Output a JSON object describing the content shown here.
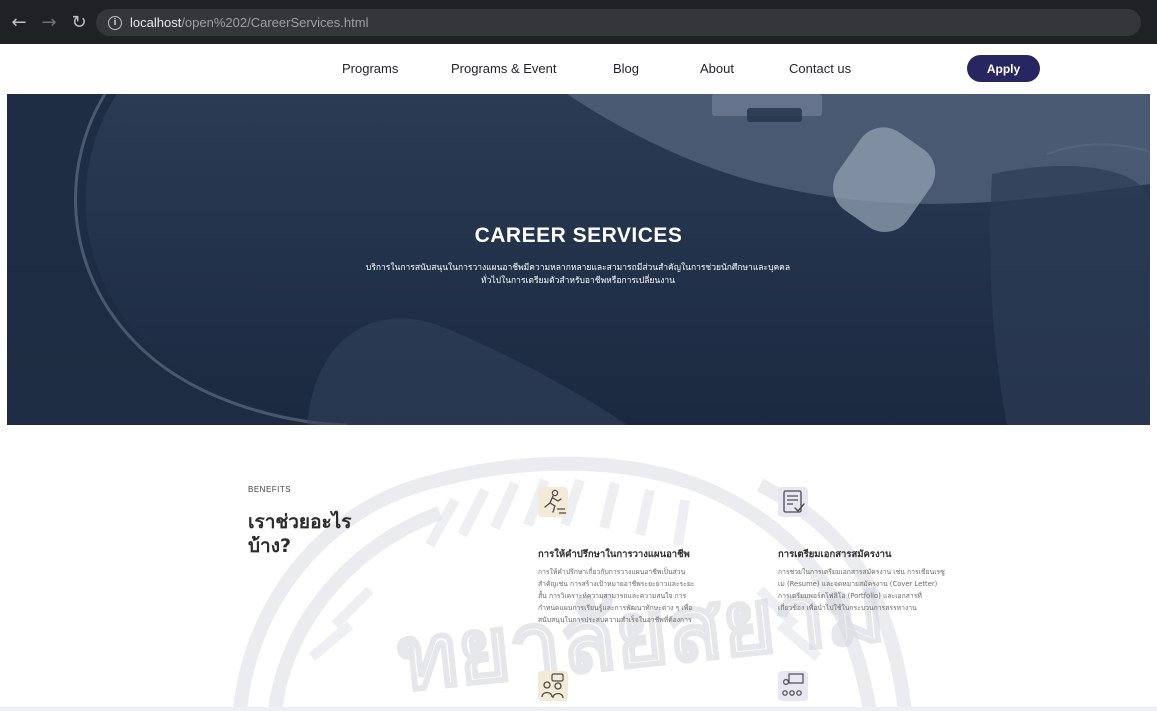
{
  "browser": {
    "url_host": "localhost",
    "url_path": "/open%202/CareerServices.html"
  },
  "nav": {
    "links": [
      "Programs",
      "Programs & Event",
      "Blog",
      "About",
      "Contact us"
    ],
    "apply_label": "Apply"
  },
  "hero": {
    "title": "CAREER SERVICES",
    "subtitle_line1": "บริการในการสนับสนุนในการวางแผนอาชีพมีความหลากหลายและสามารถมีส่วนสำคัญในการช่วยนักศึกษาและบุคคล",
    "subtitle_line2": "ทั่วไปในการเตรียมตัวสำหรับอาชีพหรือการเปลี่ยนงาน"
  },
  "benefits": {
    "eyebrow": "BENEFITS",
    "heading_line1": "เราช่วยอะไร",
    "heading_line2": "บ้าง?",
    "cards": [
      {
        "icon": "career-runner-icon",
        "title": "การให้คำปรึกษาในการวางแผนอาชีพ",
        "body_lines": [
          "การให้คำปรึกษาเกี่ยวกับการวางแผนอาชีพเป็นส่วน",
          "สำคัญเช่น การสร้างเป้าหมายอาชีพระยะยาวและระยะ",
          "สั้น การวิเคราะห์ความสามารถและความสนใจ การ",
          "กำหนดแผนการเรียนรู้และการพัฒนาทักษะต่าง ๆ เพื่อ",
          "สนับสนุนในการประสบความสำเร็จในอาชีพที่ต้องการ"
        ]
      },
      {
        "icon": "resume-document-icon",
        "title": "การเตรียมเอกสารสมัครงาน",
        "body_lines": [
          "การช่วยในการเตรียมเอกสารสมัครงาน เช่น การเขียนเรซู",
          "เม่ (Resume) และจดหมายสมัครงาน (Cover Letter)",
          "การเตรียมพอร์ตโฟลิโอ (Portfolio) และเอกสารที่",
          "เกี่ยวข้อง เพื่อนำไปใช้ในกระบวนการสรรหางาน"
        ]
      }
    ],
    "lower_icons": [
      "interview-people-icon",
      "training-group-icon"
    ]
  },
  "watermark": {
    "text": "ทยาลัยสยาม"
  },
  "colors": {
    "apply_bg": "#272660",
    "hero_overlay": "#22324a",
    "browser_bar": "#202124"
  }
}
